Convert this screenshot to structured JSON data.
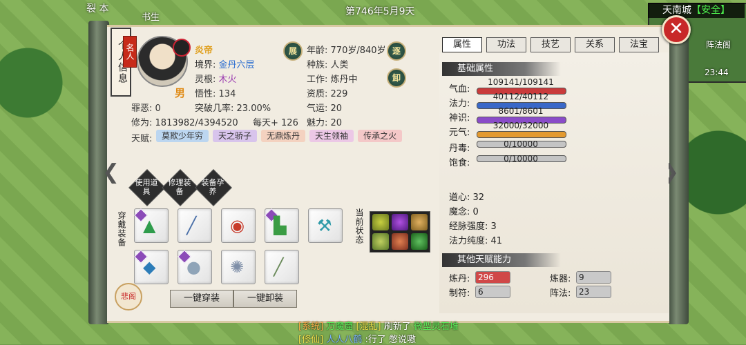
{
  "world": {
    "date": "第746年5月9天",
    "top_left_text": "裂 本",
    "top_left_text2": "书生",
    "minimap": {
      "city": "天南城",
      "status": "【安全】",
      "label": "阵法阁",
      "time": "23:44"
    }
  },
  "chat": [
    {
      "tag": "[系统]",
      "name": "万魔窟",
      "tag2": "[混乱]",
      "text": "刷新了",
      "item": "微型灵石堆"
    },
    {
      "tag": "[修仙]",
      "name": "人人八鹤",
      "text": ":行了 憋说嗷"
    }
  ],
  "panel": {
    "vertical_title": "个人信息",
    "badge": "名人",
    "name": "炎帝",
    "gender": "男",
    "realm_label": "境界:",
    "realm": "金丹六层",
    "root_label": "灵根:",
    "root": "木火",
    "insight_label": "悟性:",
    "insight": "134",
    "age_label": "年龄:",
    "age": "770岁/840岁",
    "race_label": "种族:",
    "race": "人类",
    "work_label": "工作:",
    "work": "炼丹中",
    "aptitude_label": "资质:",
    "aptitude": "229",
    "sin_label": "罪恶:",
    "sin": "0",
    "breakthrough_label": "突破几率:",
    "breakthrough": "23.00%",
    "luck_label": "气运:",
    "luck": "20",
    "cultivation_label": "修为:",
    "cultivation": "1813982/4394520",
    "daily": "每天+ 126",
    "charm_label": "魅力:",
    "charm": "20",
    "talent_label": "天赋:",
    "talents": [
      {
        "text": "莫欺少年穷",
        "color": "#bcd6f0"
      },
      {
        "text": "天之骄子",
        "color": "#d8c4ec"
      },
      {
        "text": "无鼎炼丹",
        "color": "#f4d2c0"
      },
      {
        "text": "天生领袖",
        "color": "#ecc8e6"
      },
      {
        "text": "传承之火",
        "color": "#f4c8c8"
      }
    ],
    "btn_zhan": "展",
    "btn_zhu": "逐",
    "btn_xie": "卸",
    "actions": [
      "使用道具",
      "修理装备",
      "装备孕养"
    ],
    "equip_label": "穿戴装备",
    "state_label": "当前状态",
    "equip_all": "一键穿装",
    "unequip_all": "一键卸装",
    "wisdom_label": "悲阁"
  },
  "right": {
    "tabs": [
      "属性",
      "功法",
      "技艺",
      "关系",
      "法宝"
    ],
    "basic_title": "基础属性",
    "bars": [
      {
        "label": "气血:",
        "text": "109141/109141",
        "fraction": 1.0,
        "color": "#c93b3b"
      },
      {
        "label": "法力:",
        "text": "40112/40112",
        "fraction": 1.0,
        "color": "#3a68c8"
      },
      {
        "label": "神识:",
        "text": "8601/8601",
        "fraction": 1.0,
        "color": "#8a4cc8"
      },
      {
        "label": "元气:",
        "text": "32000/32000",
        "fraction": 1.0,
        "color": "#e39a30"
      },
      {
        "label": "丹毒:",
        "text": "0/10000",
        "fraction": 0.0,
        "color": "#888888"
      },
      {
        "label": "饱食:",
        "text": "0/10000",
        "fraction": 0.0,
        "color": "#888888"
      }
    ],
    "stats": [
      {
        "label": "道心:",
        "value": "32"
      },
      {
        "label": "魔念:",
        "value": "0"
      },
      {
        "label": "经脉强度:",
        "value": "3"
      },
      {
        "label": "法力纯度:",
        "value": "41"
      }
    ],
    "other_title": "其他天赋能力",
    "abilities": [
      {
        "label": "炼丹:",
        "value": "296",
        "highlight": true
      },
      {
        "label": "炼器:",
        "value": "9",
        "highlight": false
      },
      {
        "label": "制符:",
        "value": "6",
        "highlight": false
      },
      {
        "label": "阵法:",
        "value": "23",
        "highlight": false
      }
    ]
  }
}
